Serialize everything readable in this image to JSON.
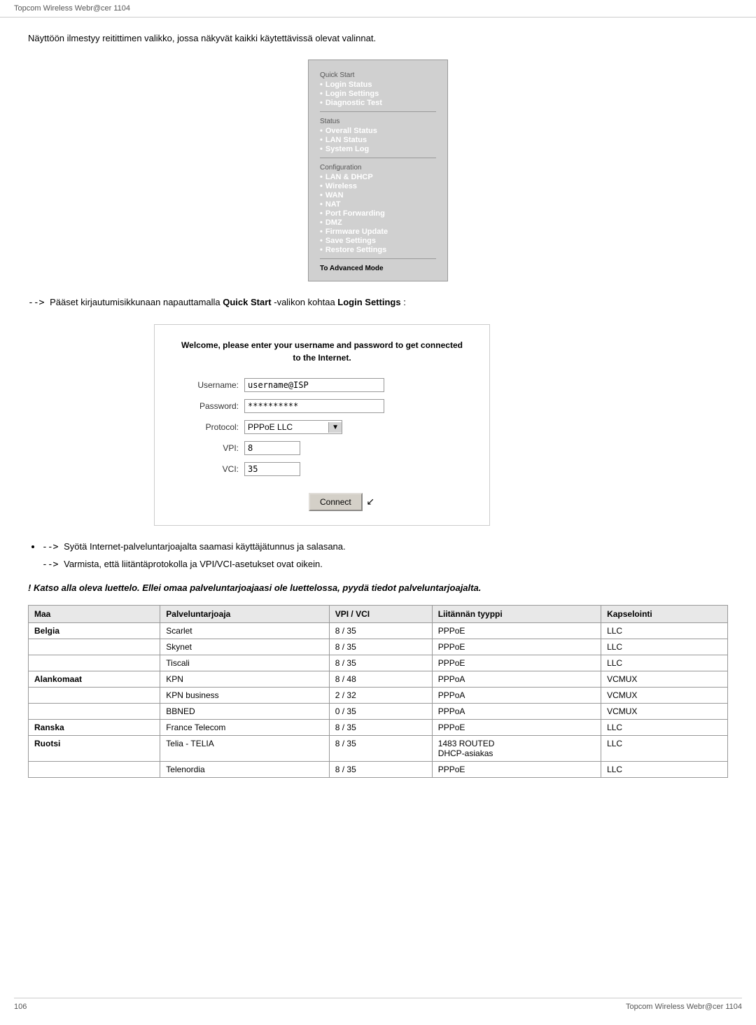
{
  "header": {
    "title": "Topcom Wireless Webr@cer 1104"
  },
  "footer": {
    "page_number": "106",
    "title": "Topcom Wireless Webr@cer 1104"
  },
  "intro": {
    "text": "Näyttöön ilmestyy reitittimen valikko, jossa näkyvät kaikki käytettävissä olevat valinnat."
  },
  "menu": {
    "sections": [
      {
        "header": "Quick Start",
        "items": [
          "Login Status",
          "Login Settings",
          "Diagnostic Test"
        ]
      },
      {
        "header": "Status",
        "items": [
          "Overall Status",
          "LAN Status",
          "System Log"
        ]
      },
      {
        "header": "Configuration",
        "items": [
          "LAN & DHCP",
          "Wireless",
          "WAN",
          "NAT",
          "Port Forwarding",
          "DMZ",
          "Firmware Update",
          "Save Settings",
          "Restore Settings"
        ]
      }
    ],
    "advanced_mode": "To Advanced Mode"
  },
  "arrow_text": {
    "line1_prefix": "-->",
    "line1_text": "Pääset kirjautumisikkunaan napauttamalla ",
    "line1_bold1": "Quick Start",
    "line1_mid": " -valikon kohtaa ",
    "line1_bold2": "Login Settings",
    "line1_end": ":"
  },
  "login_box": {
    "welcome": "Welcome, please enter your username and password to get connected\nto the Internet.",
    "username_label": "Username:",
    "username_value": "username@ISP",
    "password_label": "Password:",
    "password_value": "**********",
    "protocol_label": "Protocol:",
    "protocol_value": "PPPoE LLC",
    "vpi_label": "VPI:",
    "vpi_value": "8",
    "vci_label": "VCI:",
    "vci_value": "35",
    "connect_label": "Connect"
  },
  "bullets": [
    "Syötä Internet-palveluntarjoajalta saamasi käyttäjätunnus ja salasana.",
    "Varmista, että liitäntäprotokolla ja VPI/VCI-asetukset ovat oikein."
  ],
  "warning": "! Katso alla oleva luettelo. Ellei omaa palveluntarjoajaasi ole luettelossa, pyydä tiedot palveluntarjoajalta.",
  "table": {
    "headers": [
      "Maa",
      "Palveluntarjoaja",
      "VPI / VCI",
      "Liitännän tyyppi",
      "Kapselointi"
    ],
    "rows": [
      {
        "country": "Belgia",
        "provider": "Scarlet",
        "vpi_vci": "8 / 35",
        "type": "PPPoE",
        "encap": "LLC"
      },
      {
        "country": "",
        "provider": "Skynet",
        "vpi_vci": "8 / 35",
        "type": "PPPoE",
        "encap": "LLC"
      },
      {
        "country": "",
        "provider": "Tiscali",
        "vpi_vci": "8 / 35",
        "type": "PPPoE",
        "encap": "LLC"
      },
      {
        "country": "Alankomaat",
        "provider": "KPN",
        "vpi_vci": "8 / 48",
        "type": "PPPoA",
        "encap": "VCMUX"
      },
      {
        "country": "",
        "provider": "KPN business",
        "vpi_vci": "2 / 32",
        "type": "PPPoA",
        "encap": "VCMUX"
      },
      {
        "country": "",
        "provider": "BBNED",
        "vpi_vci": "0 / 35",
        "type": "PPPoA",
        "encap": "VCMUX"
      },
      {
        "country": "Ranska",
        "provider": "France Telecom",
        "vpi_vci": "8 / 35",
        "type": "PPPoE",
        "encap": "LLC"
      },
      {
        "country": "Ruotsi",
        "provider": "Telia - TELIA",
        "vpi_vci": "8 / 35",
        "type": "1483 ROUTED\nDHCP-asiakas",
        "encap": "LLC"
      },
      {
        "country": "",
        "provider": "Telenordia",
        "vpi_vci": "8 / 35",
        "type": "PPPoE",
        "encap": "LLC"
      }
    ]
  }
}
